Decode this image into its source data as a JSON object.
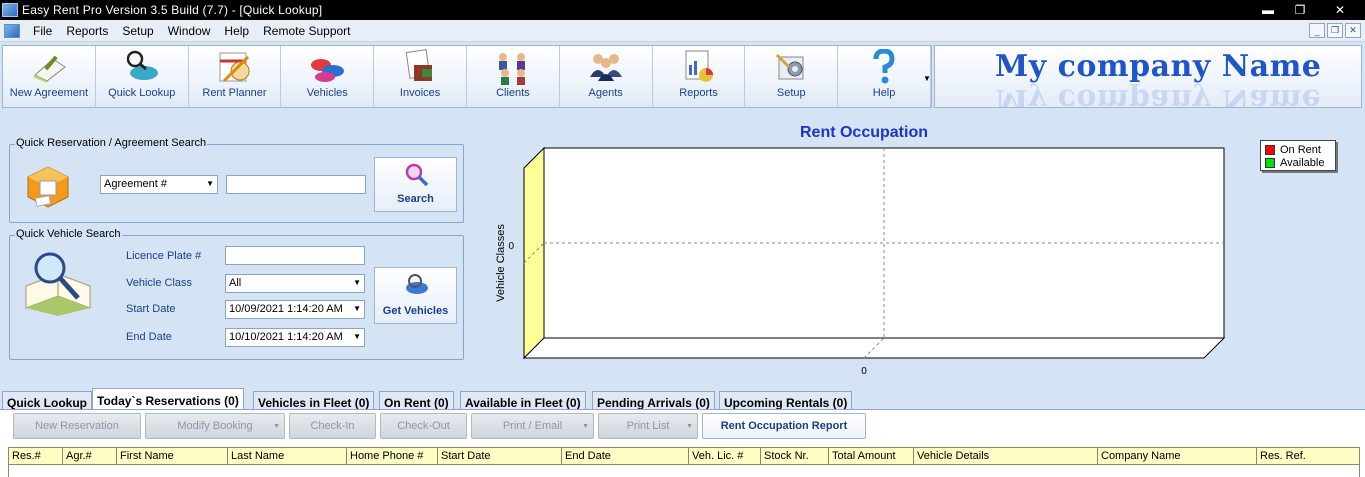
{
  "window": {
    "title": "Easy Rent Pro  Version 3.5 Build (7.7)  - [Quick Lookup]",
    "buttons": [
      "▬",
      "❐",
      "✕"
    ]
  },
  "menu": {
    "items": [
      "File",
      "Reports",
      "Setup",
      "Window",
      "Help",
      "Remote Support"
    ],
    "mdi_buttons": [
      "_",
      "❐",
      "✕"
    ]
  },
  "toolbar": {
    "buttons": [
      {
        "label": "New Agreement",
        "icon": "new-agreement-icon"
      },
      {
        "label": "Quick Lookup",
        "icon": "quick-lookup-icon"
      },
      {
        "label": "Rent Planner",
        "icon": "rent-planner-icon"
      },
      {
        "label": "Vehicles",
        "icon": "vehicles-icon"
      },
      {
        "label": "Invoices",
        "icon": "invoices-icon"
      },
      {
        "label": "Clients",
        "icon": "clients-icon"
      },
      {
        "label": "Agents",
        "icon": "agents-icon"
      },
      {
        "label": "Reports",
        "icon": "reports-icon"
      },
      {
        "label": "Setup",
        "icon": "setup-icon"
      },
      {
        "label": "Help",
        "icon": "help-icon"
      }
    ],
    "more_arrow": "▼"
  },
  "brand": {
    "name": "My company Name"
  },
  "reservation_search": {
    "legend": "Quick Reservation / Agreement Search",
    "type_value": "Agreement #",
    "search_value": "",
    "search_button": "Search"
  },
  "vehicle_search": {
    "legend": "Quick  Vehicle Search",
    "licence_label": "Licence Plate #",
    "licence_value": "",
    "class_label": "Vehicle Class",
    "class_value": "All",
    "start_label": "Start Date",
    "start_value": "10/09/2021 1:14:20 AM",
    "end_label": "End Date",
    "end_value": "10/10/2021 1:14:20 AM",
    "get_button": "Get Vehicles"
  },
  "chart_data": {
    "type": "bar",
    "title": "Rent Occupation",
    "ylabel": "Vehicle Classes",
    "xlabel": "",
    "categories": [],
    "x_ticks": [
      "0"
    ],
    "y_ticks": [
      "0"
    ],
    "series": [
      {
        "name": "On Rent",
        "values": [],
        "color": "#ff0000"
      },
      {
        "name": "Available",
        "values": [],
        "color": "#00dd00"
      }
    ],
    "grid": true,
    "legend": "top-right",
    "wall_color": "#ffff99"
  },
  "tabs": [
    {
      "label": "Quick Lookup",
      "active": false
    },
    {
      "label": "Today`s Reservations (0)",
      "active": true
    },
    {
      "label": "Vehicles in Fleet (0)",
      "active": false
    },
    {
      "label": "On Rent (0)",
      "active": false
    },
    {
      "label": "Available in Fleet (0)",
      "active": false
    },
    {
      "label": "Pending Arrivals (0)",
      "active": false
    },
    {
      "label": "Upcoming Rentals (0)",
      "active": false
    }
  ],
  "actions": [
    {
      "label": "New Reservation",
      "enabled": false,
      "dropdown": false
    },
    {
      "label": "Modify Booking",
      "enabled": false,
      "dropdown": true
    },
    {
      "label": "Check-In",
      "enabled": false,
      "dropdown": false
    },
    {
      "label": "Check-Out",
      "enabled": false,
      "dropdown": false
    },
    {
      "label": "Print / Email",
      "enabled": false,
      "dropdown": true
    },
    {
      "label": "Print List",
      "enabled": false,
      "dropdown": true
    },
    {
      "label": "Rent Occupation Report",
      "enabled": true,
      "dropdown": false
    }
  ],
  "grid_columns": [
    "Res.#",
    "Agr.#",
    "First Name",
    "Last Name",
    "Home Phone #",
    "Start Date",
    "End Date",
    "Veh. Lic. #",
    "Stock Nr.",
    "Total Amount",
    "Vehicle Details",
    "Company Name",
    "Res. Ref."
  ]
}
